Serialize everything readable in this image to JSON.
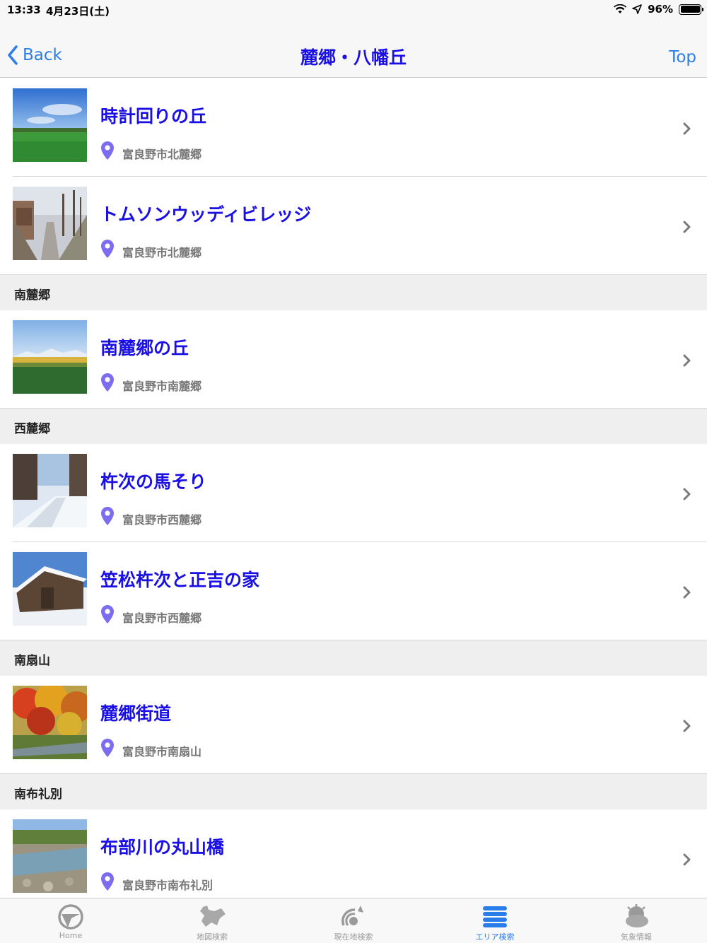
{
  "status": {
    "time": "13:33",
    "date": "4月23日(土)",
    "battery": "96%"
  },
  "nav": {
    "back": "Back",
    "title": "麓郷・八幡丘",
    "top": "Top"
  },
  "items": [
    {
      "title": "時計回りの丘",
      "address": "富良野市北麓郷"
    },
    {
      "title": "トムソンウッディビレッジ",
      "address": "富良野市北麓郷"
    },
    {
      "title": "南麓郷の丘",
      "address": "富良野市南麓郷"
    },
    {
      "title": "杵次の馬そり",
      "address": "富良野市西麓郷"
    },
    {
      "title": "笠松杵次と正吉の家",
      "address": "富良野市西麓郷"
    },
    {
      "title": "麓郷街道",
      "address": "富良野市南扇山"
    },
    {
      "title": "布部川の丸山橋",
      "address": "富良野市南布礼別"
    }
  ],
  "sections": [
    "南麓郷",
    "西麓郷",
    "南扇山",
    "南布礼別"
  ],
  "tabs": [
    {
      "label": "Home",
      "icon": "home-icon"
    },
    {
      "label": "地図検索",
      "icon": "map-search-icon"
    },
    {
      "label": "現在地検索",
      "icon": "location-search-icon"
    },
    {
      "label": "エリア検索",
      "icon": "area-search-icon"
    },
    {
      "label": "気象情報",
      "icon": "weather-icon"
    }
  ],
  "colors": {
    "accent": "#2b7de9",
    "title": "#1a10e6",
    "pin": "#7b6cf0"
  }
}
